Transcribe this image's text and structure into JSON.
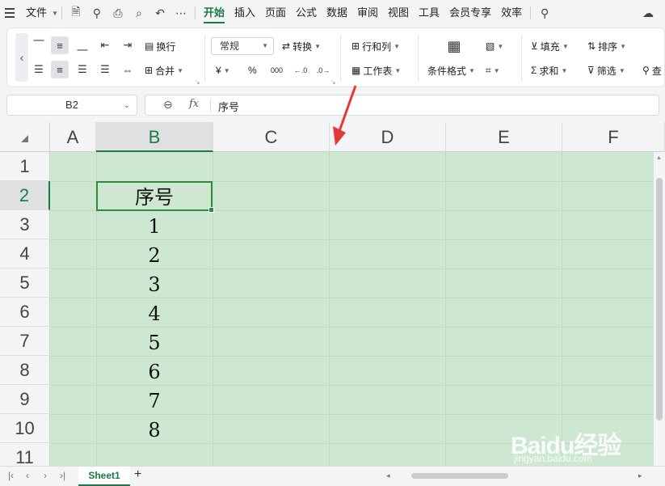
{
  "menubar": {
    "file_label": "文件",
    "tabs": [
      "开始",
      "插入",
      "页面",
      "公式",
      "数据",
      "审阅",
      "视图",
      "工具",
      "会员专享",
      "效率"
    ],
    "active_tab": "开始"
  },
  "ribbon": {
    "wrap_label": "换行",
    "merge_label": "合并",
    "number_format": "常规",
    "convert_label": "转换",
    "currency_symbol": "¥",
    "percent_symbol": "%",
    "thousands_symbol": "000",
    "row_col_label": "行和列",
    "worksheet_label": "工作表",
    "cond_format_label": "条件格式",
    "fill_label": "填充",
    "sort_label": "排序",
    "sum_label": "求和",
    "filter_label": "筛选",
    "cut_label": "查"
  },
  "formula_bar": {
    "name_box": "B2",
    "fx_label": "fx",
    "content": "序号"
  },
  "grid": {
    "columns": [
      "A",
      "B",
      "C",
      "D",
      "E",
      "F"
    ],
    "selected_column": "B",
    "rows": [
      "1",
      "2",
      "3",
      "4",
      "5",
      "6",
      "7",
      "8",
      "9",
      "10",
      "11"
    ],
    "selected_row": "2",
    "column_b_values": [
      "",
      "序号",
      "1",
      "2",
      "3",
      "4",
      "5",
      "6",
      "7",
      "8",
      ""
    ],
    "fill_color": "#cde7d1",
    "accent_color": "#1d7a46"
  },
  "sheets": {
    "tabs": [
      "Sheet1"
    ],
    "add_label": "+"
  },
  "watermark": {
    "logo": "Baidu经验",
    "site": "jingyan.baidu.com"
  }
}
